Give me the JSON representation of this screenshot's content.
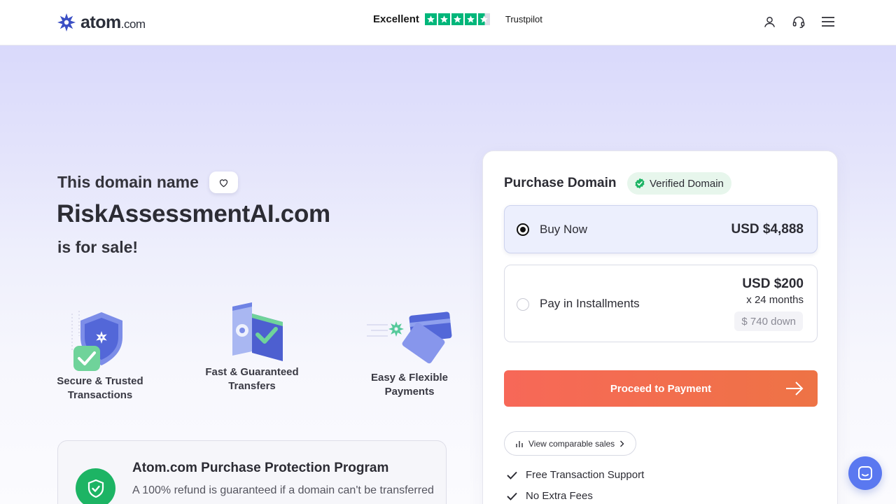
{
  "header": {
    "logo": {
      "name": "atom",
      "tld": ".com"
    },
    "trustpilot": {
      "rating_label": "Excellent",
      "stars": 4.5,
      "brand": "Trustpilot",
      "star_color": "#00b67a"
    },
    "icons": [
      "user-icon",
      "headset-icon",
      "menu-icon"
    ]
  },
  "hero": {
    "eyebrow": "This domain name",
    "domain": "RiskAssessmentAI.com",
    "for_sale": "is for sale!"
  },
  "features": [
    {
      "label": "Secure & Trusted Transactions",
      "icon": "shield-check-illustration"
    },
    {
      "label": "Fast & Guaranteed Transfers",
      "icon": "transfer-illustration"
    },
    {
      "label": "Easy & Flexible Payments",
      "icon": "cards-illustration"
    }
  ],
  "protection": {
    "title": "Atom.com Purchase Protection Program",
    "text": "A 100% refund is guaranteed if a domain can't be transferred"
  },
  "purchase": {
    "title": "Purchase Domain",
    "verified_label": "Verified Domain",
    "options": [
      {
        "label": "Buy Now",
        "price": "USD $4,888",
        "selected": true
      },
      {
        "label": "Pay in Installments",
        "price": "USD $200",
        "term": "x 24 months",
        "down": "$ 740 down",
        "selected": false
      }
    ],
    "cta_label": "Proceed to Payment",
    "compare_label": "View comparable sales",
    "perks": [
      "Free Transaction Support",
      "No Extra Fees"
    ]
  },
  "colors": {
    "accent_start": "#f76858",
    "accent_end": "#ee7345",
    "verified_green": "#1db464",
    "chat_blue": "#5a78f0"
  }
}
